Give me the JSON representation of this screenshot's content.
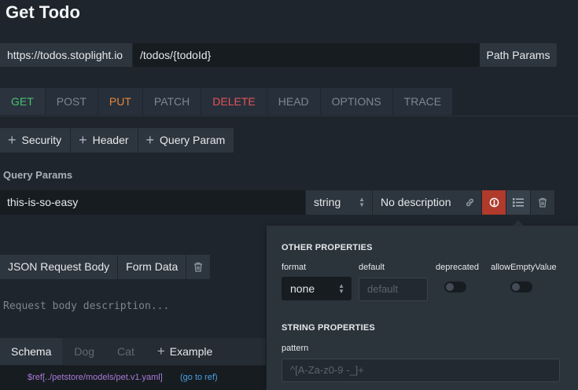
{
  "page": {
    "title": "Get Todo"
  },
  "url": {
    "base": "https://todos.stoplight.io",
    "path": "/todos/{todoId}",
    "path_params_label": "Path Params"
  },
  "methods": [
    "GET",
    "POST",
    "PUT",
    "PATCH",
    "DELETE",
    "HEAD",
    "OPTIONS",
    "TRACE"
  ],
  "colors": {
    "get": "#4bbf73",
    "put": "#e8853b",
    "delete": "#e5525a",
    "required": "#b03a2b",
    "ref": "#a97ad8",
    "link": "#4a9fe0"
  },
  "add_buttons": {
    "security": "Security",
    "header": "Header",
    "query_param": "Query Param"
  },
  "query_params": {
    "label": "Query Params",
    "param": {
      "name": "this-is-so-easy",
      "type": "string",
      "description": "No description"
    }
  },
  "body": {
    "tabs": {
      "json": "JSON Request Body",
      "form": "Form Data"
    },
    "description_placeholder": "Request body description..."
  },
  "schema": {
    "tabs": {
      "schema": "Schema",
      "dog": "Dog",
      "cat": "Cat",
      "example": "Example"
    },
    "ref": "$ref[../petstore/models/pet.v1.yaml]",
    "go_to_ref": "(go to ref)"
  },
  "popover": {
    "other_heading": "OTHER PROPERTIES",
    "format_label": "format",
    "format_value": "none",
    "default_label": "default",
    "default_placeholder": "default",
    "deprecated_label": "deprecated",
    "allow_empty_label": "allowEmptyValue",
    "string_heading": "STRING PROPERTIES",
    "pattern_label": "pattern",
    "pattern_placeholder": "^[A-Za-z0-9 -_]+"
  }
}
